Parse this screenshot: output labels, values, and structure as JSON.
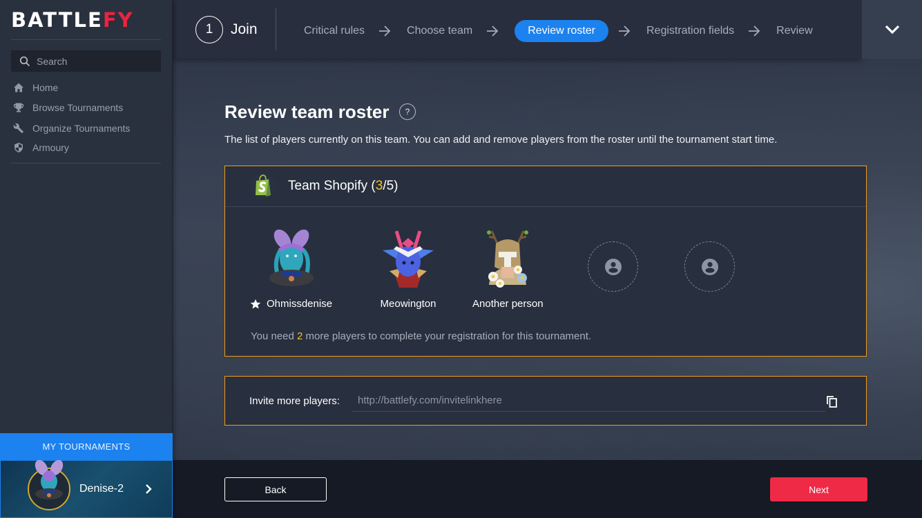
{
  "brand": {
    "part1": "BATTLE",
    "part2": "FY",
    "accent_color": "#e8253f"
  },
  "sidebar": {
    "search_placeholder": "Search",
    "items": [
      {
        "label": "Home",
        "icon": "home-icon"
      },
      {
        "label": "Browse Tournaments",
        "icon": "trophy-icon"
      },
      {
        "label": "Organize Tournaments",
        "icon": "wrench-icon"
      },
      {
        "label": "Armoury",
        "icon": "shield-icon"
      }
    ],
    "my_tournaments_label": "MY TOURNAMENTS",
    "tournament": {
      "name": "Denise-2"
    }
  },
  "stepper": {
    "number": "1",
    "title": "Join",
    "steps": [
      {
        "label": "Critical rules",
        "active": false
      },
      {
        "label": "Choose team",
        "active": false
      },
      {
        "label": "Review roster",
        "active": true
      },
      {
        "label": "Registration fields",
        "active": false
      },
      {
        "label": "Review",
        "active": false
      }
    ]
  },
  "page": {
    "title": "Review team roster",
    "help": "?",
    "description": "The list of players currently on this team. You can add and remove players from the roster until the tournament start time."
  },
  "team": {
    "name": "Team Shopify",
    "count_open": " (",
    "current": "3",
    "separator": "/",
    "max": "5",
    "count_close": ")",
    "players": [
      {
        "name": "Ohmissdenise",
        "captain": true
      },
      {
        "name": "Meowington",
        "captain": false
      },
      {
        "name": "Another person",
        "captain": false
      }
    ],
    "empty_slots": 2,
    "need_prefix": "You need ",
    "need_count": "2",
    "need_suffix": " more players to complete your registration for this tournament."
  },
  "invite": {
    "label": "Invite more players:",
    "value": "http://battlefy.com/invitelinkhere"
  },
  "footer": {
    "back_label": "Back",
    "next_label": "Next"
  },
  "colors": {
    "primary": "#1b82ef",
    "highlight": "#f5c518",
    "border": "#f39c1a",
    "danger": "#ee2a46"
  }
}
